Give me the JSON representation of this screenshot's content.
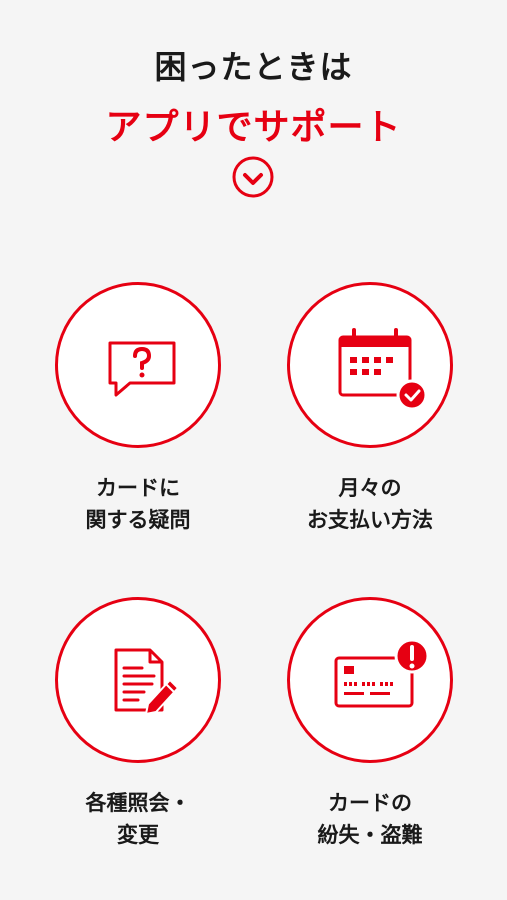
{
  "header": {
    "title_line1": "困ったときは",
    "title_line2": "アプリでサポート",
    "accent_color": "#e60012"
  },
  "items": [
    {
      "line1": "カードに",
      "line2": "関する疑問",
      "icon": "question-bubble-icon"
    },
    {
      "line1": "月々の",
      "line2": "お支払い方法",
      "icon": "calendar-check-icon"
    },
    {
      "line1": "各種照会・",
      "line2": "変更",
      "icon": "document-edit-icon"
    },
    {
      "line1": "カードの",
      "line2": "紛失・盗難",
      "icon": "card-alert-icon"
    }
  ]
}
